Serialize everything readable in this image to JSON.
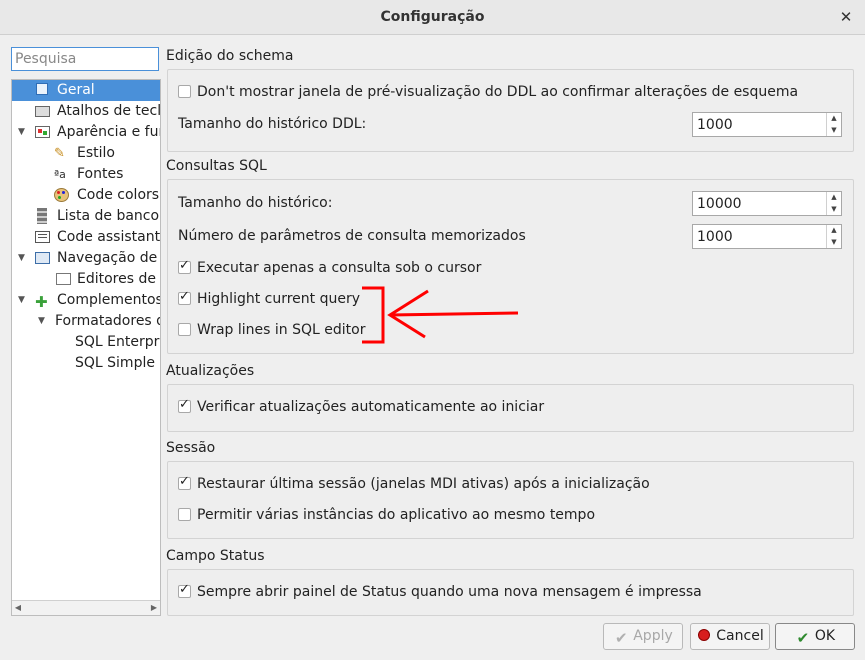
{
  "window": {
    "title": "Configuração"
  },
  "search": {
    "placeholder": "Pesquisa"
  },
  "tree": [
    {
      "label": "Geral",
      "icon": "general-icon",
      "selected": true
    },
    {
      "label": "Atalhos de tecla",
      "icon": "keyboard-icon"
    },
    {
      "label": "Aparência e fun",
      "icon": "appearance-icon"
    },
    {
      "label": "Estilo",
      "icon": "wand-icon"
    },
    {
      "label": "Fontes",
      "icon": "font-icon"
    },
    {
      "label": "Code colors",
      "icon": "palette-icon"
    },
    {
      "label": "Lista de banco d",
      "icon": "database-list-icon"
    },
    {
      "label": "Code assistant",
      "icon": "code-assistant-icon"
    },
    {
      "label": "Navegação de d",
      "icon": "navigation-icon"
    },
    {
      "label": "Editores de c",
      "icon": "editors-icon"
    },
    {
      "label": "Complementos",
      "icon": "puzzle-icon"
    },
    {
      "label": "Formatadores d",
      "icon": ""
    },
    {
      "label": "SQL Enterpris",
      "icon": ""
    },
    {
      "label": "SQL Simple",
      "icon": ""
    }
  ],
  "sections": {
    "schema": {
      "title": "Edição do schema",
      "ddl_preview": {
        "label": "Don't mostrar janela de pré-visualização do DDL ao confirmar alterações de esquema",
        "checked": false
      },
      "ddl_history": {
        "label": "Tamanho do histórico DDL:",
        "value": "1000"
      }
    },
    "sql": {
      "title": "Consultas SQL",
      "history": {
        "label": "Tamanho do histórico:",
        "value": "10000"
      },
      "params": {
        "label": "Número de parâmetros de consulta memorizados",
        "value": "1000"
      },
      "exec_cursor": {
        "label": "Executar apenas a consulta sob o cursor",
        "checked": true
      },
      "highlight": {
        "label": "Highlight current query",
        "checked": true
      },
      "wrap": {
        "label": "Wrap lines in SQL editor",
        "checked": false
      }
    },
    "updates": {
      "title": "Atualizações",
      "auto_check": {
        "label": "Verificar atualizações automaticamente ao iniciar",
        "checked": true
      }
    },
    "session": {
      "title": "Sessão",
      "restore": {
        "label": "Restaurar última sessão (janelas MDI ativas) após a inicialização",
        "checked": true
      },
      "multi": {
        "label": "Permitir várias instâncias do aplicativo ao mesmo tempo",
        "checked": false
      }
    },
    "status": {
      "title": "Campo Status",
      "open_panel": {
        "label": "Sempre abrir painel de Status quando uma nova mensagem é impressa",
        "checked": true
      }
    }
  },
  "buttons": {
    "apply": "Apply",
    "cancel": "Cancel",
    "ok": "OK"
  },
  "colors": {
    "selection": "#4a90d9",
    "annotation": "#ff0000"
  }
}
